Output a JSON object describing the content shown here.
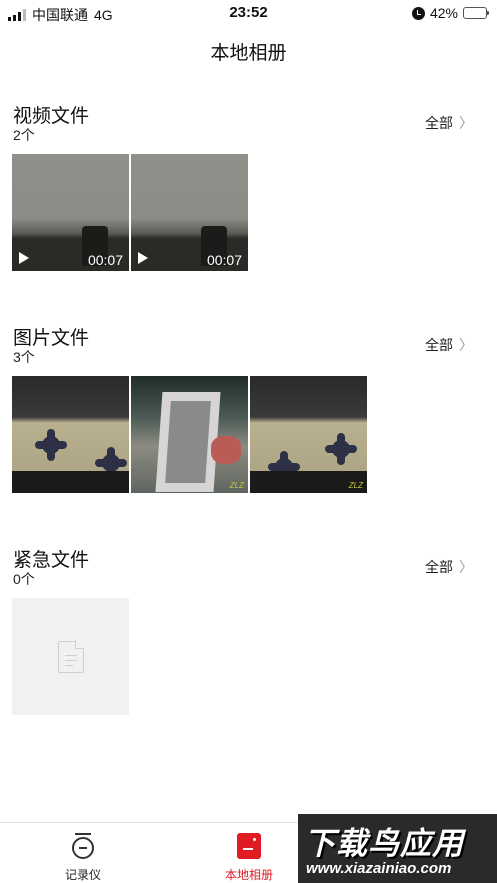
{
  "status_bar": {
    "carrier": "中国联通",
    "network": "4G",
    "time": "23:52",
    "battery": "42%",
    "battery_level": 0.42
  },
  "nav": {
    "title": "本地相册"
  },
  "sections": [
    {
      "title": "视频文件",
      "count": "2个",
      "all_label": "全部",
      "items": [
        {
          "type": "video",
          "duration": "00:07"
        },
        {
          "type": "video",
          "duration": "00:07"
        }
      ]
    },
    {
      "title": "图片文件",
      "count": "3个",
      "all_label": "全部",
      "items": [
        {
          "type": "photo"
        },
        {
          "type": "photo"
        },
        {
          "type": "photo"
        }
      ]
    },
    {
      "title": "紧急文件",
      "count": "0个",
      "all_label": "全部",
      "items": [
        {
          "type": "empty"
        }
      ]
    }
  ],
  "tab_bar": {
    "tabs": [
      {
        "label": "记录仪",
        "icon": "recorder-icon",
        "active": false
      },
      {
        "label": "本地相册",
        "icon": "album-icon",
        "active": true
      }
    ],
    "active_color": "#e01b24"
  },
  "watermark": {
    "title": "下载鸟应用",
    "url": "www.xiazainiao.com"
  }
}
